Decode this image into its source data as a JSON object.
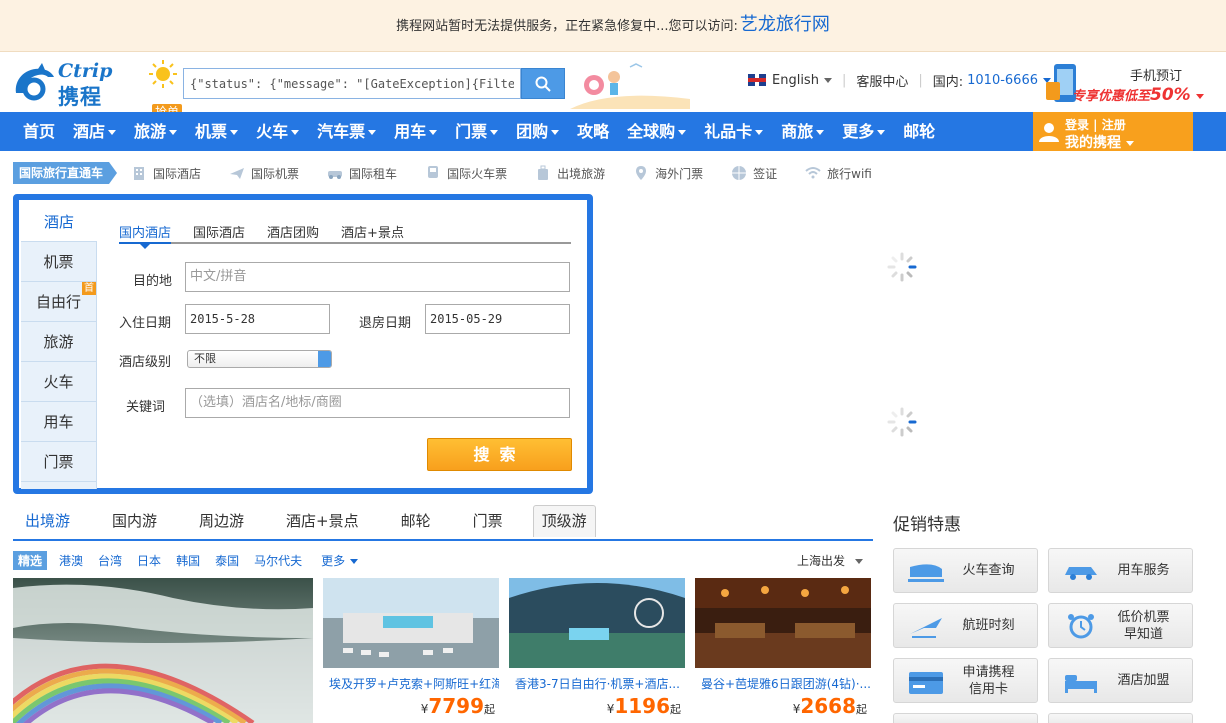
{
  "notice": {
    "text": "携程网站暂时无法提供服务，正在紧急修复中...您可以访问:",
    "link": "艺龙旅行网"
  },
  "header": {
    "logo_en": "Ctrip",
    "logo_cn": "携程",
    "search_value": "{\"status\": {\"message\": \"[GateException]{Filter threw Exception",
    "qiangdan": "抢单",
    "language": "English",
    "service": "客服中心",
    "phone_label": "国内:",
    "phone_number": "1010-6666",
    "mobile_title": "手机预订",
    "mobile_promo": "专享优惠低至",
    "mobile_discount": "50%"
  },
  "nav": {
    "items": [
      {
        "label": "首页",
        "dd": false
      },
      {
        "label": "酒店",
        "dd": true
      },
      {
        "label": "旅游",
        "dd": true
      },
      {
        "label": "机票",
        "dd": true
      },
      {
        "label": "火车",
        "dd": true
      },
      {
        "label": "汽车票",
        "dd": true
      },
      {
        "label": "用车",
        "dd": true
      },
      {
        "label": "门票",
        "dd": true
      },
      {
        "label": "团购",
        "dd": true
      },
      {
        "label": "攻略",
        "dd": false
      },
      {
        "label": "全球购",
        "dd": true
      },
      {
        "label": "礼品卡",
        "dd": true
      },
      {
        "label": "商旅",
        "dd": true
      },
      {
        "label": "更多",
        "dd": true
      },
      {
        "label": "邮轮",
        "dd": false
      }
    ],
    "login": "登录 | 注册",
    "my_ctrip": "我的携程"
  },
  "intl": {
    "tag": "国际旅行直通车",
    "items": [
      {
        "label": "国际酒店",
        "icon": "hotel-icon"
      },
      {
        "label": "国际机票",
        "icon": "plane-icon"
      },
      {
        "label": "国际租车",
        "icon": "car-icon"
      },
      {
        "label": "国际火车票",
        "icon": "train-icon"
      },
      {
        "label": "出境旅游",
        "icon": "luggage-icon"
      },
      {
        "label": "海外门票",
        "icon": "pin-icon"
      },
      {
        "label": "签证",
        "icon": "globe-icon"
      },
      {
        "label": "旅行wifi",
        "icon": "wifi-icon"
      }
    ]
  },
  "panel": {
    "side_tabs": [
      "酒店",
      "机票",
      "自由行",
      "旅游",
      "火车",
      "用车",
      "门票"
    ],
    "shou": "首",
    "hotel_tabs": [
      "国内酒店",
      "国际酒店",
      "酒店团购",
      "酒店+景点"
    ],
    "dest_label": "目的地",
    "dest_placeholder": "中文/拼音",
    "checkin_label": "入住日期",
    "checkin_value": "2015-5-28",
    "checkout_label": "退房日期",
    "checkout_value": "2015-05-29",
    "level_label": "酒店级别",
    "level_value": "不限",
    "keyword_label": "关键词",
    "keyword_placeholder": "（选填）酒店名/地标/商圈",
    "search_btn": "搜索"
  },
  "travel": {
    "tabs": [
      "出境游",
      "国内游",
      "周边游",
      "酒店+景点",
      "邮轮",
      "门票"
    ],
    "top_tab": "顶级游",
    "jingxuan": "精选",
    "dests": [
      "港澳",
      "台湾",
      "日本",
      "韩国",
      "泰国",
      "马尔代夫"
    ],
    "more": "更多",
    "depart": "上海出发",
    "cards": [
      {
        "title": "埃及开罗+卢克索+阿斯旺+红海...",
        "price": "7799"
      },
      {
        "title": "香港3-7日自由行·机票+酒店...",
        "price": "1196"
      },
      {
        "title": "曼谷+芭堤雅6日跟团游(4钻)·...",
        "price": "2668"
      }
    ],
    "yen": "¥",
    "qi": "起"
  },
  "promo": {
    "title": "促销特惠",
    "buttons": [
      {
        "label": "火车查询",
        "icon": "train-icon"
      },
      {
        "label": "用车服务",
        "icon": "car-icon"
      },
      {
        "label": "航班时刻",
        "icon": "plane-icon"
      },
      {
        "label": "低价机票\n早知道",
        "icon": "alarm-clock-icon"
      },
      {
        "label": "申请携程\n信用卡",
        "icon": "credit-card-icon"
      },
      {
        "label": "酒店加盟",
        "icon": "bed-icon"
      }
    ]
  },
  "colors": {
    "nav_blue": "#2577e3",
    "accent_orange": "#f8a01d",
    "link_blue": "#1769d1",
    "price_orange": "#ff6600"
  }
}
